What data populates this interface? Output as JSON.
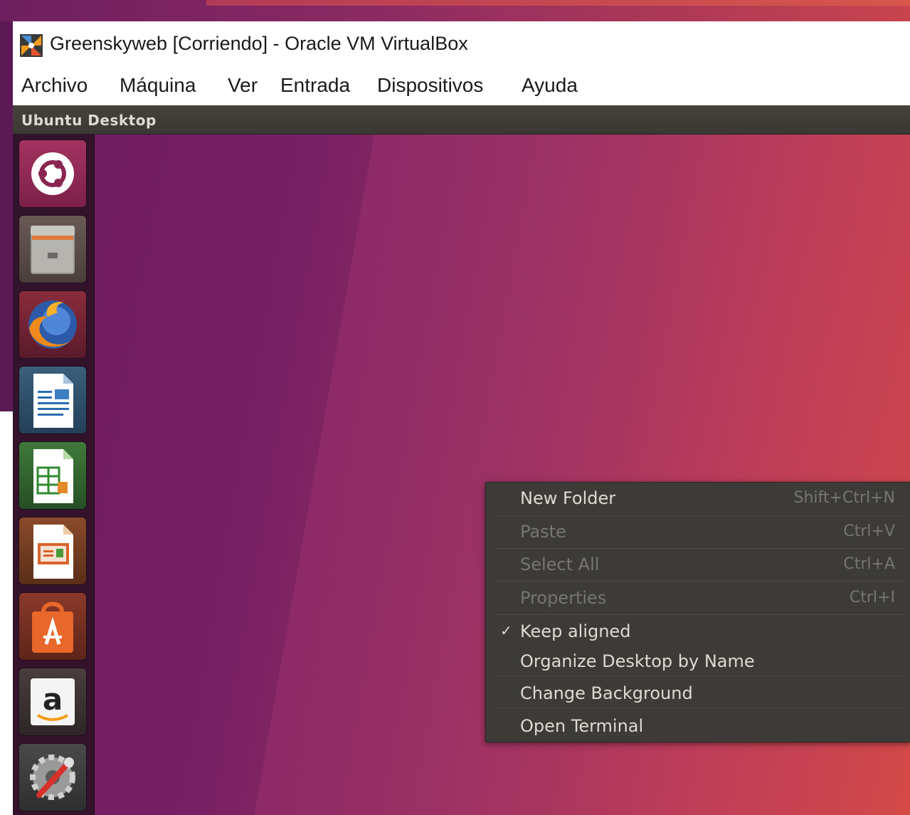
{
  "window": {
    "title": "Greenskyweb [Corriendo] - Oracle VM VirtualBox"
  },
  "menubar": {
    "items": [
      {
        "label": "Archivo"
      },
      {
        "label": "Máquina"
      },
      {
        "label": "Ver"
      },
      {
        "label": "Entrada"
      },
      {
        "label": "Dispositivos"
      },
      {
        "label": "Ayuda"
      }
    ]
  },
  "guest": {
    "topbar_title": "Ubuntu Desktop"
  },
  "launcher": {
    "items": [
      {
        "icon": "ubuntu-dash-icon"
      },
      {
        "icon": "files-icon"
      },
      {
        "icon": "firefox-icon"
      },
      {
        "icon": "libreoffice-writer-icon"
      },
      {
        "icon": "libreoffice-calc-icon"
      },
      {
        "icon": "libreoffice-impress-icon"
      },
      {
        "icon": "ubuntu-software-icon"
      },
      {
        "icon": "amazon-icon"
      },
      {
        "icon": "system-settings-icon"
      }
    ]
  },
  "context_menu": {
    "items": [
      {
        "label": "New Folder",
        "accel": "Shift+Ctrl+N",
        "enabled": true
      },
      {
        "label": "Paste",
        "accel": "Ctrl+V",
        "enabled": false
      },
      {
        "label": "Select All",
        "accel": "Ctrl+A",
        "enabled": false
      },
      {
        "label": "Properties",
        "accel": "Ctrl+I",
        "enabled": false
      },
      {
        "label": "Keep aligned",
        "accel": "",
        "enabled": true,
        "checked": true
      },
      {
        "label": "Organize Desktop by Name",
        "accel": "",
        "enabled": true
      },
      {
        "label": "Change Background",
        "accel": "",
        "enabled": true
      },
      {
        "label": "Open Terminal",
        "accel": "",
        "enabled": true
      }
    ]
  },
  "colors": {
    "menu_bg": "#3c3b37",
    "menu_text": "#dfdbd2",
    "menu_disabled": "#77756f",
    "panel_bg": "#3a3833"
  }
}
